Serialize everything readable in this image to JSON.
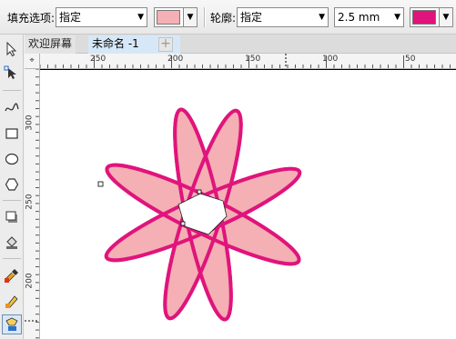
{
  "property_bar": {
    "fill_label": "填充选项:",
    "fill_mode": "指定",
    "fill_color": "#f4b0b4",
    "outline_label": "轮廓:",
    "outline_mode": "指定",
    "outline_width": "2.5 mm",
    "outline_color": "#e0147c"
  },
  "tabs": {
    "welcome": "欢迎屏幕",
    "document": "未命名 -1",
    "add": "+"
  },
  "ruler": {
    "h_ticks": [
      "250",
      "200",
      "150",
      "100",
      "50"
    ],
    "v_ticks": [
      "300",
      "250",
      "200"
    ]
  },
  "toolbox": {
    "icons": [
      "pick-tool-icon",
      "shape-tool-icon",
      "freehand-tool-icon",
      "rectangle-tool-icon",
      "ellipse-tool-icon",
      "polygon-tool-icon",
      "shadow-tool-icon",
      "fill-tool-icon",
      "eyedropper-tool-icon",
      "interactive-fill-icon",
      "smart-fill-icon"
    ],
    "active": "smart-fill-icon"
  },
  "colors": {
    "petal_fill": "#f4b0b4",
    "petal_outline": "#e0147c",
    "tab_active": "#d6e8f7"
  }
}
